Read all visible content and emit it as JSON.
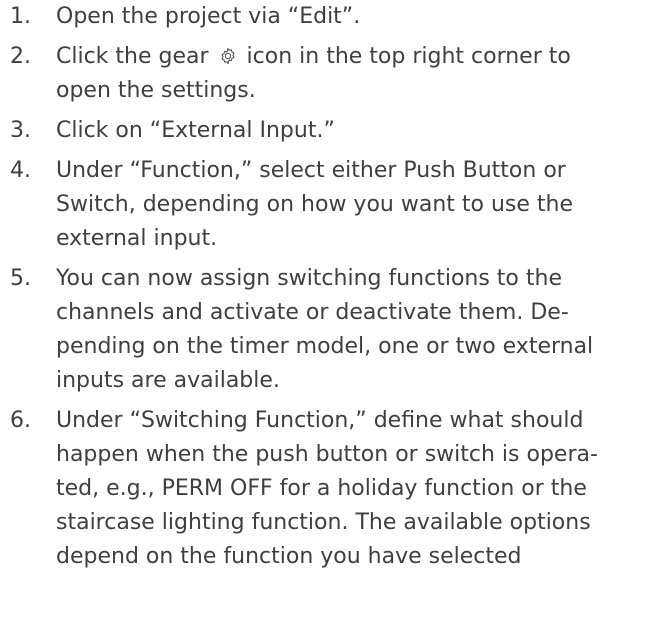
{
  "steps": [
    {
      "number": "1.",
      "lines": [
        "Open the project via “Edit”."
      ]
    },
    {
      "number": "2.",
      "line1_before_icon": "Click the gear",
      "icon": "gear-icon",
      "line1_after_icon": "icon in the top right corner to",
      "lines_after": [
        "open the settings."
      ]
    },
    {
      "number": "3.",
      "lines": [
        "Click on “External Input.”"
      ]
    },
    {
      "number": "4.",
      "lines": [
        "Under “Function,” select either Push Button or",
        "Switch, depending on how you want to use the",
        "external input."
      ]
    },
    {
      "number": "5.",
      "lines": [
        "You can now assign switching functions to the",
        "channels and activate or deactivate them. De-",
        "pending on the timer model, one or two external",
        "inputs are available."
      ]
    },
    {
      "number": "6.",
      "lines": [
        "Under “Switching Function,” define what should",
        "happen when the push button or switch is opera-",
        "ted, e.g., PERM OFF for a holiday function or the",
        "staircase lighting function. The available options",
        "depend on the function you have selected"
      ]
    }
  ]
}
